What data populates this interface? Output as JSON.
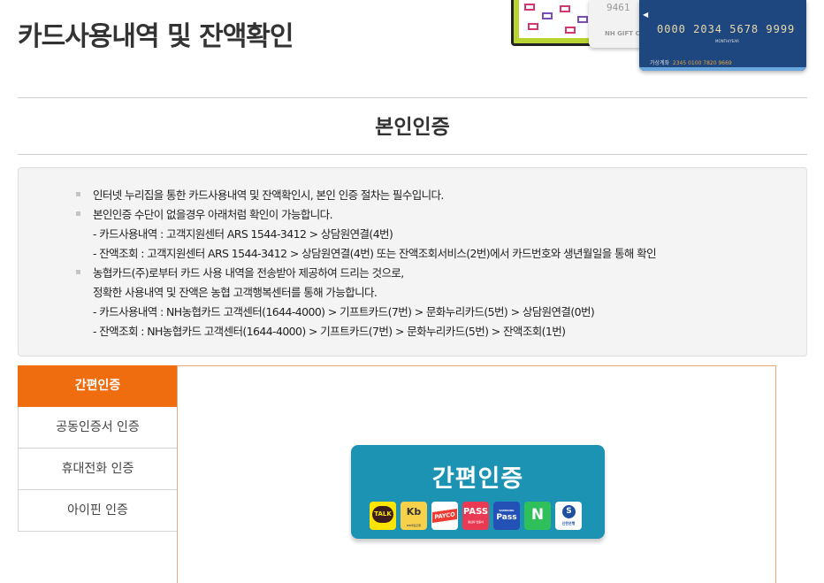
{
  "page": {
    "title": "카드사용내역 및 잔액확인"
  },
  "illustration": {
    "card_white_number": "9461",
    "card_white_label": "NH GIFT CA",
    "card_blue_number": "0000 2034 5678 9999",
    "card_blue_expiry": "MONTH/YEAR",
    "card_blue_sub_label": "가상계좌",
    "card_blue_sub_number": "2345 0100 7820 9669"
  },
  "section": {
    "title": "본인인증"
  },
  "notice": {
    "lines": [
      "인터넷 누리집을 통한 카드사용내역 및 잔액확인시, 본인 인증 절차는 필수입니다.",
      "본인인증 수단이 없을경우 아래처럼 확인이 가능합니다.",
      "- 카드사용내역 : 고객지원센터 ARS 1544-3412 > 상담원연결(4번)",
      "- 잔액조회 : 고객지원센터 ARS 1544-3412 > 상담원연결(4번) 또는 잔액조회서비스(2번)에서 카드번호와 생년월일을 통해 확인",
      "농협카드(주)로부터 카드 사용 내역을 전송받아 제공하여 드리는 것으로,",
      "정확한 사용내역 및 잔액은 농협 고객행복센터를 통해 가능합니다.",
      "- 카드사용내역 : NH농협카드 고객센터(1644-4000) > 기프트카드(7번) > 문화누리카드(5번) > 상담원연결(0번)",
      "- 잔액조회 : NH농협카드 고객센터(1644-4000) > 기프트카드(7번) > 문화누리카드(5번) > 잔액조회(1번)"
    ]
  },
  "nav": {
    "items": [
      "간편인증",
      "공동인증서 인증",
      "휴대전화 인증",
      "아이핀 인증"
    ],
    "active_index": 0
  },
  "simple_auth": {
    "title": "간편인증",
    "providers": [
      {
        "icon": "kakao-talk-icon",
        "mark": "TALK"
      },
      {
        "icon": "kb-bank-icon",
        "mark": "Kb",
        "caption": "KB국민은행"
      },
      {
        "icon": "payco-icon",
        "mark": "PAYCO"
      },
      {
        "icon": "pass-icon",
        "mark": "PASS",
        "caption": "통신사 인증서"
      },
      {
        "icon": "samsung-pass-icon",
        "mark": "Pass",
        "caption": "SAMSUNG"
      },
      {
        "icon": "naver-icon",
        "mark": "N"
      },
      {
        "icon": "shinhan-bank-icon",
        "mark": "S",
        "caption": "신한은행"
      }
    ]
  },
  "colors": {
    "accent_orange": "#ef6c0f",
    "button_teal": "#1c93b2",
    "notice_bg": "#f4f4f4"
  }
}
